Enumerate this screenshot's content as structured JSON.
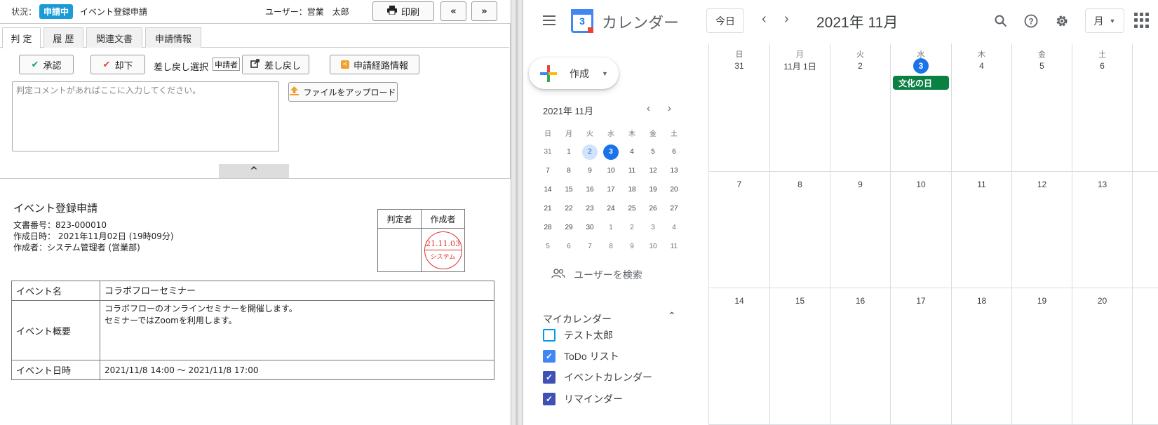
{
  "workflow": {
    "status_label": "状況：",
    "status_badge": "申請中",
    "doc_type": "イベント登録申請",
    "user_label": "ユーザー：営業　太郎",
    "print_label": "印刷",
    "prev_label": "«",
    "next_label": "»",
    "tabs": [
      "判 定",
      "履 歴",
      "関連文書",
      "申請情報"
    ],
    "approve_label": "承認",
    "reject_label": "却下",
    "return_select_label": "差し戻し選択",
    "return_select_value": "申請者",
    "return_label": "差し戻し",
    "route_label": "申請経路情報",
    "comment_placeholder": "判定コメントがあればここに入力してください。",
    "upload_label": "ファイルをアップロード",
    "collapse_glyph": "^"
  },
  "document": {
    "title": "イベント登録申請",
    "number": "文書番号：823-000010",
    "created": "作成日時： 2021年11月02日 (19時09分)",
    "author": "作成者：システム管理者 (営業部)",
    "stamp_headers": [
      "判定者",
      "作成者"
    ],
    "stamp_date": "21.11.03",
    "stamp_name": "システム",
    "fields": {
      "name_label": "イベント名",
      "name_value": "コラボフローセミナー",
      "summary_label": "イベント概要",
      "summary_lines": [
        "コラボフローのオンラインセミナーを開催します。",
        "セミナーではZoomを利用します。"
      ],
      "date_label": "イベント日時",
      "date_value": "2021/11/8  14:00 ～ 2021/11/8  17:00"
    }
  },
  "calendar": {
    "app_title": "カレンダー",
    "logo_day": "3",
    "today_label": "今日",
    "month_title": "2021年 11月",
    "view_label": "月",
    "create_label": "作成",
    "mini": {
      "title": "2021年 11月",
      "weekdays": [
        "日",
        "月",
        "火",
        "水",
        "木",
        "金",
        "土"
      ],
      "weeks": [
        [
          "31",
          "1",
          "2",
          "3",
          "4",
          "5",
          "6"
        ],
        [
          "7",
          "8",
          "9",
          "10",
          "11",
          "12",
          "13"
        ],
        [
          "14",
          "15",
          "16",
          "17",
          "18",
          "19",
          "20"
        ],
        [
          "21",
          "22",
          "23",
          "24",
          "25",
          "26",
          "27"
        ],
        [
          "28",
          "29",
          "30",
          "1",
          "2",
          "3",
          "4"
        ],
        [
          "5",
          "6",
          "7",
          "8",
          "9",
          "10",
          "11"
        ]
      ],
      "selected": "2",
      "today": "3"
    },
    "people_search": "ユーザーを検索",
    "my_calendars_title": "マイカレンダー",
    "my_calendars": [
      {
        "name": "テスト太郎",
        "checked": false,
        "color": "#039be5"
      },
      {
        "name": "ToDo リスト",
        "checked": true,
        "color": "#4285f4"
      },
      {
        "name": "イベントカレンダー",
        "checked": true,
        "color": "#3f51b5"
      },
      {
        "name": "リマインダー",
        "checked": true,
        "color": "#3f51b5"
      }
    ],
    "weekdays": [
      "日",
      "月",
      "火",
      "水",
      "木",
      "金",
      "土"
    ],
    "weeks": [
      [
        "31",
        "11月 1日",
        "2",
        "3",
        "4",
        "5",
        "6"
      ],
      [
        "7",
        "8",
        "9",
        "10",
        "11",
        "12",
        "13"
      ],
      [
        "14",
        "15",
        "16",
        "17",
        "18",
        "19",
        "20"
      ]
    ],
    "today_date": "3",
    "event": {
      "title": "文化の日",
      "date": "3",
      "color": "#0b8043"
    }
  }
}
